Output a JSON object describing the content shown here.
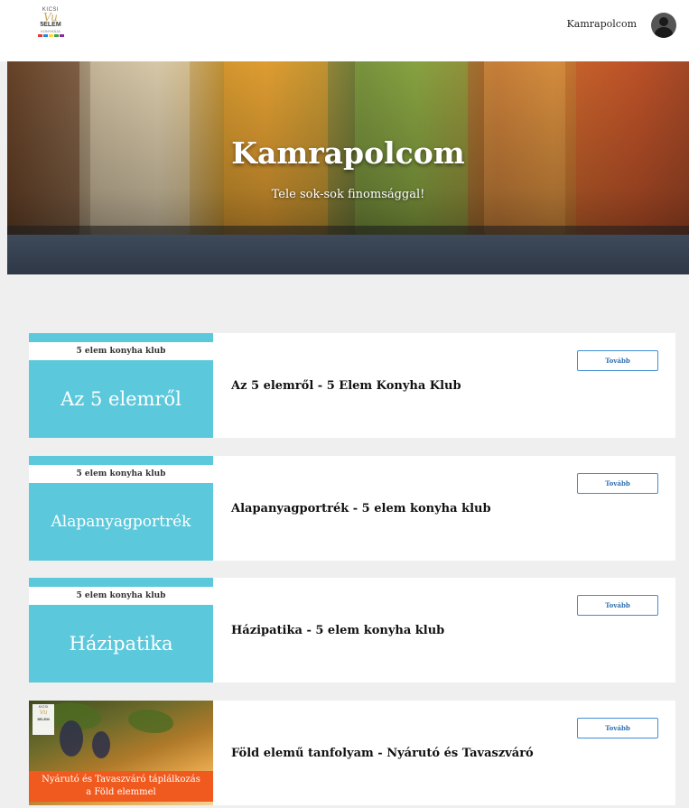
{
  "header": {
    "logo": {
      "line1": "KICSI",
      "line2": "Vu",
      "line3": "5ELEM",
      "line4": "KONYHÁJA",
      "bar_colors": [
        "#e53935",
        "#1e88e5",
        "#fdd835",
        "#43a047",
        "#8e24aa"
      ]
    },
    "account_name": "Kamrapolcom"
  },
  "hero": {
    "title": "Kamrapolcom",
    "subtitle": "Tele sok-sok finomsággal!"
  },
  "courses": [
    {
      "thumb_top": "5 elem konyha klub",
      "thumb_big": "Az 5 elemről",
      "title": "Az 5 elemről - 5 Elem Konyha Klub",
      "button": "Tovább"
    },
    {
      "thumb_top": "5 elem konyha klub",
      "thumb_big": "Alapanyagportrék",
      "title": "Alapanyagportrék - 5 elem konyha klub",
      "button": "Tovább"
    },
    {
      "thumb_top": "5 elem konyha klub",
      "thumb_big": "Házipatika",
      "title": "Házipatika - 5 elem konyha klub",
      "button": "Tovább"
    },
    {
      "thumb_logo": [
        "KICSI",
        "Vu",
        "5ELEM"
      ],
      "thumb_band_line1": "Nyárutó és Tavaszváró táplálkozás",
      "thumb_band_line2": "a Föld elemmel",
      "title": "Föld elemű tanfolyam - Nyárutó és Tavaszváró",
      "button": "Tovább"
    }
  ],
  "colors": {
    "accent_teal": "#5bc8dc",
    "button_border": "#3f8fd6",
    "orange_band": "#f05a1e",
    "page_bg": "#efefef"
  }
}
